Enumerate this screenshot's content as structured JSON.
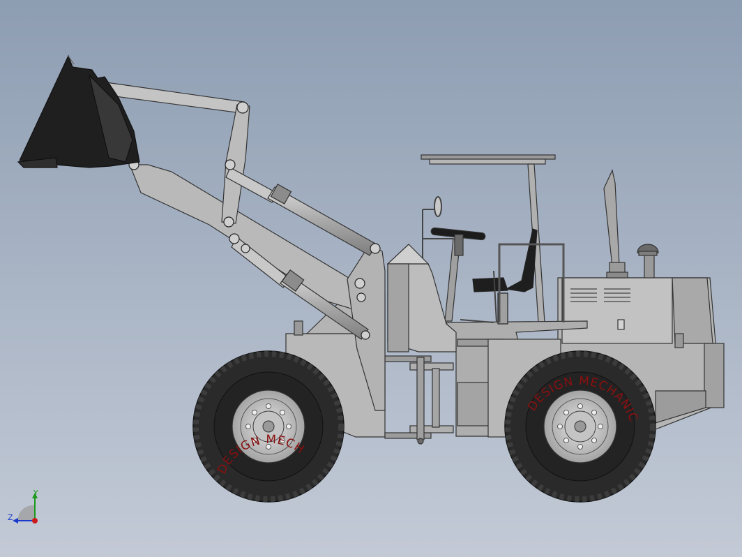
{
  "tire_text_front": "DESIGN MECHANIC",
  "tire_text_rear": "DESIGN MECHANIC",
  "triad": {
    "y_label": "Y",
    "z_label": "Z"
  },
  "colors": {
    "background_top": "#8d9db2",
    "background_bottom": "#c3cad6",
    "body": "#b4b4b4",
    "body_dark": "#8f8f8f",
    "tire": "#2d2d2d",
    "tire_text": "#8a1010",
    "bucket": "#1e1e1e"
  }
}
